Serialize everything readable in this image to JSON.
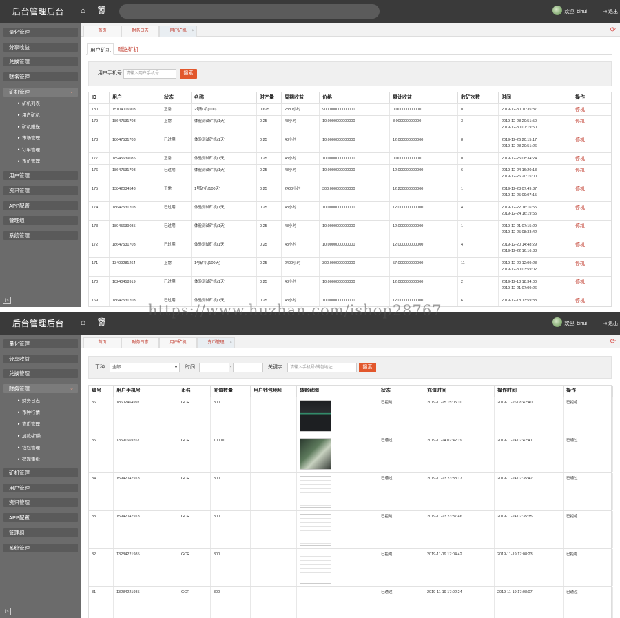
{
  "app": {
    "title": "后台管理后台",
    "user": "欢迎, bihui",
    "logout": "退出"
  },
  "s1": {
    "sidebar": [
      {
        "label": "量化管理"
      },
      {
        "label": "分享收益"
      },
      {
        "label": "兑换管理"
      },
      {
        "label": "财务管理"
      },
      {
        "label": "矿机管理"
      },
      {
        "label": "用户管理"
      },
      {
        "label": "资讯管理"
      },
      {
        "label": "APP配置"
      },
      {
        "label": "管理组"
      },
      {
        "label": "系统管理"
      }
    ],
    "submenu": [
      "矿机列表",
      "用户矿机",
      "矿机赠送",
      "市场管理",
      "订单管理",
      "币价管理"
    ],
    "tabs": [
      "首页",
      "财务日志",
      "用户矿机"
    ],
    "subtabs": [
      "用户矿机",
      "赠送矿机"
    ],
    "filter": {
      "label": "用户手机号:",
      "placeholder": "请输入用户手机号",
      "button": "搜索"
    },
    "columns": [
      "ID",
      "用户",
      "状态",
      "名称",
      "时产量",
      "周期收益",
      "价格",
      "累计收益",
      "收矿次数",
      "时间",
      "操作"
    ],
    "rows": [
      [
        "180",
        "15104006903",
        "正常",
        "2号矿机(100)",
        "0.625",
        "2880小时",
        "900.000000000000",
        "0.000000000000",
        "0",
        "2019-12-30 10:35:37",
        "",
        "停机"
      ],
      [
        "179",
        "18647531703",
        "正常",
        "体验测试矿机(1天)",
        "0.25",
        "48小时",
        "10.0000000000000",
        "8.000000000000",
        "3",
        "2019-12-28 20:51:50",
        "2019-12-30 07:19:50",
        "停机"
      ],
      [
        "178",
        "18647531703",
        "已过期",
        "体验测试矿机(1天)",
        "0.25",
        "48小时",
        "10.0000000000000",
        "12.000000000000",
        "8",
        "2019-12-26 20:15:17",
        "2019-12-28 20:51:26",
        "停机"
      ],
      [
        "177",
        "18945639085",
        "正常",
        "体验测试矿机(1天)",
        "0.25",
        "48小时",
        "10.0000000000000",
        "0.000000000000",
        "0",
        "2019-12-25 08:34:24",
        "",
        "停机"
      ],
      [
        "176",
        "18647531703",
        "已过期",
        "体验测试矿机(1天)",
        "0.25",
        "48小时",
        "10.0000000000000",
        "12.000000000000",
        "6",
        "2019-12-24 16:20:13",
        "2019-12-26 20:15:00",
        "停机"
      ],
      [
        "175",
        "13842034543",
        "正常",
        "1号矿机(100天)",
        "0.25",
        "2400小时",
        "300.000000000000",
        "12.230000000000",
        "1",
        "2019-12-23 07:49:37",
        "2019-12-25 09:07:15",
        "停机"
      ],
      [
        "174",
        "18647531703",
        "已过期",
        "体验测试矿机(1天)",
        "0.25",
        "48小时",
        "10.0000000000000",
        "12.000000000000",
        "4",
        "2019-12-22 16:16:55",
        "2019-12-24 16:19:55",
        "停机"
      ],
      [
        "173",
        "18945639085",
        "已过期",
        "体验测试矿机(1天)",
        "0.25",
        "48小时",
        "10.0000000000000",
        "12.000000000000",
        "1",
        "2019-12-21 07:15:29",
        "2019-12-25 08:33:42",
        "停机"
      ],
      [
        "172",
        "18647531703",
        "已过期",
        "体验测试矿机(1天)",
        "0.25",
        "48小时",
        "10.0000000000000",
        "12.000000000000",
        "4",
        "2019-12-20 14:48:29",
        "2019-12-22 16:16:38",
        "停机"
      ],
      [
        "171",
        "13409281264",
        "正常",
        "1号矿机(100天)",
        "0.25",
        "2400小时",
        "300.000000000000",
        "57.000000000000",
        "11",
        "2019-12-20 12:09:28",
        "2019-12-30 03:59:02",
        "停机"
      ],
      [
        "170",
        "18240458919",
        "已过期",
        "体验测试矿机(1天)",
        "0.25",
        "48小时",
        "10.0000000000000",
        "12.000000000000",
        "2",
        "2019-12-18 18:34:00",
        "2019-12-21 07:09:26",
        "停机"
      ],
      [
        "169",
        "18647531703",
        "已过期",
        "体验测试矿机(1天)",
        "0.25",
        "48小时",
        "10.0000000000000",
        "12.000000000000",
        "6",
        "2019-12-18 13:59:33",
        "",
        "停机"
      ]
    ]
  },
  "s2": {
    "sidebar": [
      {
        "label": "量化管理"
      },
      {
        "label": "分享收益"
      },
      {
        "label": "兑换管理"
      },
      {
        "label": "财务管理"
      },
      {
        "label": "矿机管理"
      },
      {
        "label": "用户管理"
      },
      {
        "label": "资讯管理"
      },
      {
        "label": "APP配置"
      },
      {
        "label": "管理组"
      },
      {
        "label": "系统管理"
      }
    ],
    "submenu": [
      "财务日志",
      "币种行情",
      "充币管理",
      "加款/扣款",
      "钱包管理",
      "提现审批"
    ],
    "tabs": [
      "首页",
      "财务日志",
      "用户矿机",
      "充币管理"
    ],
    "filter": {
      "coin_label": "币种:",
      "coin_value": "全部",
      "time_label": "时间:",
      "dash": "-",
      "kw_label": "关键字:",
      "kw_placeholder": "请输入手机号/钱包地址...",
      "button": "搜索"
    },
    "columns": [
      "编号",
      "用户手机号",
      "币名",
      "充值数量",
      "用户钱包地址",
      "转账截图",
      "状态",
      "充值时间",
      "操作时间",
      "操作"
    ],
    "rows": [
      [
        "36",
        "18602464997",
        "GCR",
        "300",
        "",
        "",
        "已拒绝",
        "2019-11-25 15:05:10",
        "2019-11-26 08:42:40",
        "已拒绝"
      ],
      [
        "35",
        "13591669767",
        "GCR",
        "10000",
        "",
        "",
        "已通过",
        "2019-11-24 07:42:19",
        "2019-11-24 07:42:41",
        "已通过"
      ],
      [
        "34",
        "15942047918",
        "GCR",
        "300",
        "",
        "",
        "已通过",
        "2019-11-23 23:38:17",
        "2019-11-24 07:35:42",
        "已通过"
      ],
      [
        "33",
        "15942047918",
        "GCR",
        "300",
        "",
        "",
        "已拒绝",
        "2019-11-23 23:37:46",
        "2019-11-24 07:35:35",
        "已拒绝"
      ],
      [
        "32",
        "13284221985",
        "GCR",
        "300",
        "",
        "",
        "已拒绝",
        "2019-11-19 17:04:42",
        "2019-11-19 17:08:23",
        "已拒绝"
      ],
      [
        "31",
        "13284221985",
        "GCR",
        "300",
        "",
        "",
        "已通过",
        "2019-11-19 17:02:24",
        "2019-11-19 17:08:07",
        "已通过"
      ]
    ]
  },
  "watermark": "https://www.huzhan.com/ishop28767",
  "colors": {
    "topbar": "#3a3a3a",
    "sidebar": "#6b6b6b",
    "accent": "#e2572c",
    "link": "#c0392b"
  }
}
